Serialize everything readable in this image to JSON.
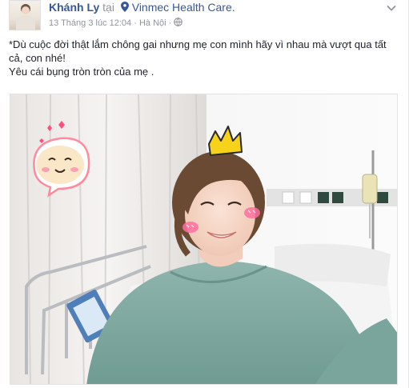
{
  "post": {
    "author": "Khánh Ly",
    "at_word": "tại",
    "place": "Vinmec Health Care.",
    "timestamp": "13 Tháng 3 lúc 12:04",
    "separator": "·",
    "city": "Hà Nội",
    "caption_line1": "*Dù cuộc đời thật lắm chông gai nhưng mẹ con mình hãy vì nhau mà vượt qua tất cả, con nhé!",
    "caption_line2": "Yêu cái bụng tròn tròn của mẹ ."
  },
  "colors": {
    "link": "#365899",
    "meta": "#90949c",
    "text": "#1d2129"
  },
  "icons": {
    "pin": "map-pin-icon",
    "privacy": "globe-icon",
    "menu": "chevron-down-icon"
  }
}
